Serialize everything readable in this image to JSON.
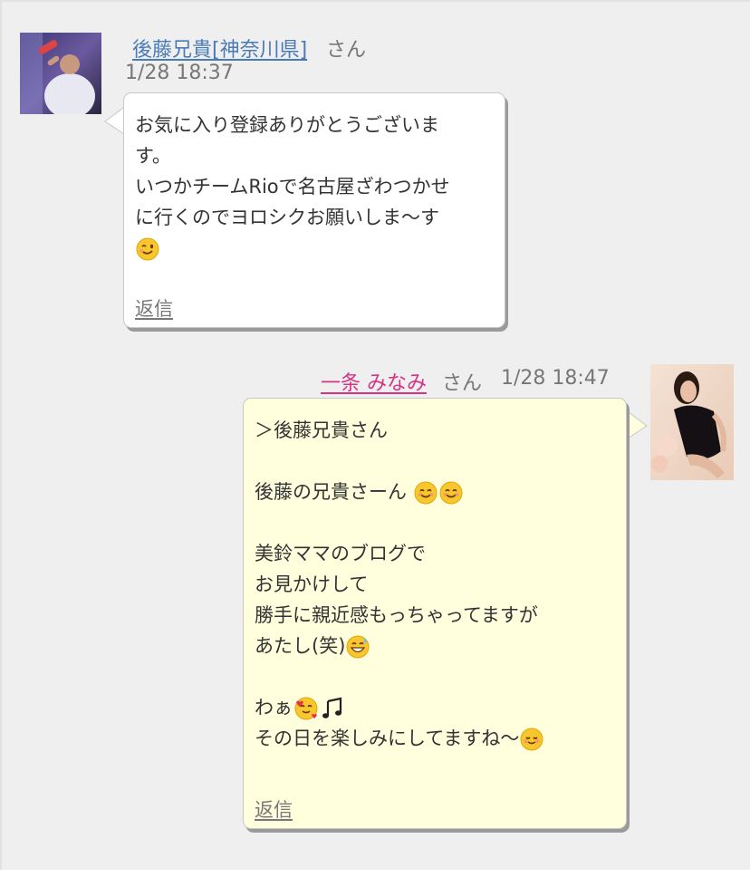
{
  "message1": {
    "sender_name": "後藤兄貴[神奈川県]",
    "sender_suffix": "さん",
    "timestamp": "1/28 18:37",
    "lines": [
      "お気に入り登録ありがとうございま",
      "す。",
      "いつかチームRioで名古屋ざわつかせ",
      "に行くのでヨロシクお願いしま〜す"
    ],
    "emoji_line": "wink-emoji",
    "reply_label": "返信",
    "bubble_color": "#ffffff",
    "name_color": "#4a7bb7"
  },
  "message2": {
    "sender_name": "一条 みなみ",
    "sender_suffix": "さん",
    "timestamp": "1/28 18:47",
    "line_quote": "＞後藤兄貴さん",
    "line_greeting": "後藤の兄貴さーん",
    "line_blog1": "美鈴ママのブログで",
    "line_blog2": "お見かけして",
    "line_blog3": "勝手に親近感もっちゃってますが",
    "line_blog4": "あたし(笑)",
    "line_wa": "わぁ",
    "line_last": "その日を楽しみにしてますね〜",
    "reply_label": "返信",
    "bubble_color": "#ffffdd",
    "name_color": "#d63384"
  }
}
